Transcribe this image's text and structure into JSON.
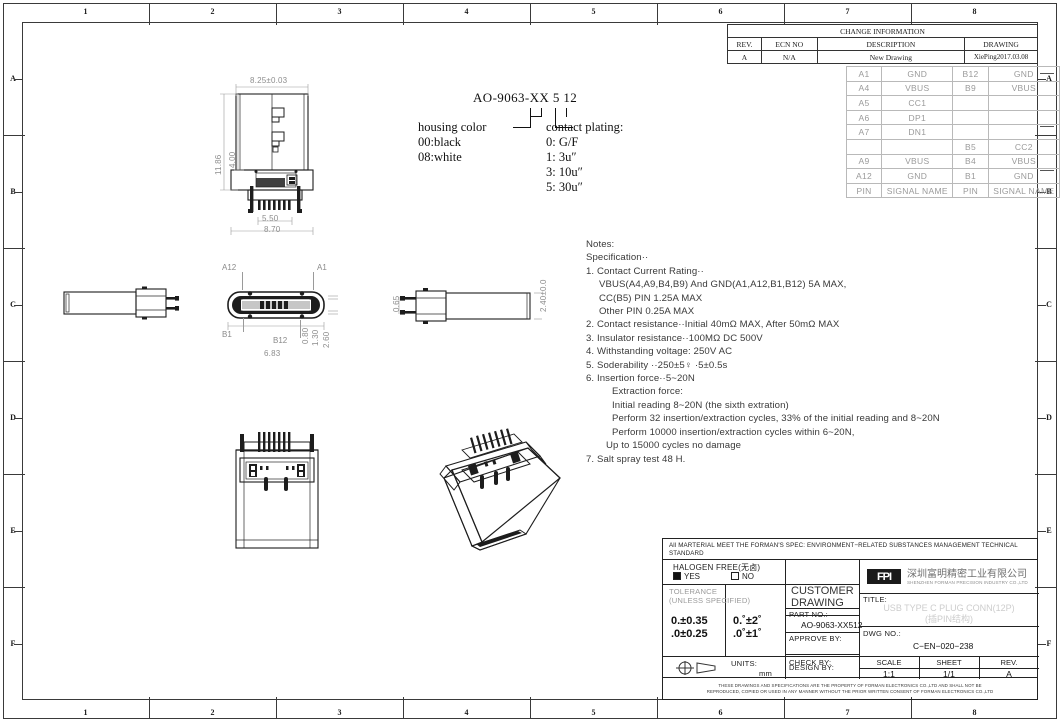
{
  "sheet": {
    "zones_top": [
      "1",
      "2",
      "3",
      "4",
      "5",
      "6",
      "7",
      "8"
    ],
    "zones_bottom": [
      "1",
      "2",
      "3",
      "4",
      "5",
      "6",
      "7",
      "8"
    ],
    "rows_left": [
      "A",
      "B",
      "C",
      "D",
      "E",
      "F"
    ],
    "rows_right": [
      "A",
      "B",
      "C",
      "D",
      "E",
      "F"
    ]
  },
  "change_info": {
    "title": "CHANGE  INFORMATION",
    "headers": [
      "REV.",
      "ECN NO",
      "DESCRIPTION",
      "DRAWING"
    ],
    "rows": [
      {
        "rev": "A",
        "ecn": "N/A",
        "description": "New Drawing",
        "drawing": "XiePing2017.03.08"
      }
    ]
  },
  "pin_table": {
    "rows": [
      {
        "pin_a": "A1",
        "sig_a": "GND",
        "pin_b": "B12",
        "sig_b": "GND"
      },
      {
        "pin_a": "A4",
        "sig_a": "VBUS",
        "pin_b": "B9",
        "sig_b": "VBUS"
      },
      {
        "pin_a": "A5",
        "sig_a": "CC1",
        "pin_b": "",
        "sig_b": ""
      },
      {
        "pin_a": "A6",
        "sig_a": "DP1",
        "pin_b": "",
        "sig_b": ""
      },
      {
        "pin_a": "A7",
        "sig_a": "DN1",
        "pin_b": "",
        "sig_b": ""
      },
      {
        "pin_a": "",
        "sig_a": "",
        "pin_b": "B5",
        "sig_b": "CC2"
      },
      {
        "pin_a": "A9",
        "sig_a": "VBUS",
        "pin_b": "B4",
        "sig_b": "VBUS"
      },
      {
        "pin_a": "A12",
        "sig_a": "GND",
        "pin_b": "B1",
        "sig_b": "GND"
      },
      {
        "pin_a": "PIN",
        "sig_a": "SIGNAL  NAME",
        "pin_b": "PIN",
        "sig_b": "SIGNAL  NAME"
      }
    ]
  },
  "part_number_legend": {
    "code": "AO-9063-XX 5 12",
    "housing_label": "housing color",
    "housing_options": [
      "00:black",
      "08:white"
    ],
    "plating_label": "contact plating:",
    "plating_options": [
      "0: G/F",
      "1: 3u″",
      "3: 10u″",
      "5: 30u″"
    ]
  },
  "notes": {
    "heading": "Notes:",
    "subheading": "Specification··",
    "lines": [
      {
        "indent": 0,
        "text": "1. Contact Current Rating··"
      },
      {
        "indent": 1,
        "text": "VBUS(A4,A9,B4,B9) And GND(A1,A12,B1,B12) 5A MAX,"
      },
      {
        "indent": 1,
        "text": "CC(B5) PIN 1.25A MAX"
      },
      {
        "indent": 1,
        "text": "Other PIN 0.25A MAX"
      },
      {
        "indent": 0,
        "text": "2. Contact resistance··Initial 40mΩ MAX, After 50mΩ MAX"
      },
      {
        "indent": 0,
        "text": "3. Insulator resistance··100MΩ  DC 500V"
      },
      {
        "indent": 0,
        "text": "4. Withstanding voltage: 250V AC"
      },
      {
        "indent": 0,
        "text": "5. Soderability ··250±5♀ ·5±0.5s"
      },
      {
        "indent": 0,
        "text": "6. Insertion force··5~20N"
      },
      {
        "indent": 2,
        "text": "Extraction force:"
      },
      {
        "indent": 2,
        "text": "Initial reading 8~20N (the sixth extration)"
      },
      {
        "indent": 2,
        "text": "Perform 32 insertion/extraction cycles, 33% of the initial reading and 8~20N"
      },
      {
        "indent": 2,
        "text": "Perform 10000 insertion/extraction cycles within 6~20N,"
      },
      {
        "indent": 3,
        "text": "Up to 15000 cycles no damage"
      },
      {
        "indent": 0,
        "text": "7. Salt spray test 48 H."
      }
    ]
  },
  "dimensions": {
    "front_width_top": "8.25±0.03",
    "front_height_outer": "11.86",
    "front_height_inner": "4.00",
    "front_width_inner": "5.50",
    "front_width_bottom": "8.70",
    "top_view_width": "6.83",
    "top_view_d1": "0.80",
    "top_view_d2": "1.30",
    "top_view_d3": "2.60",
    "side_view_thk": "0.65",
    "side_view_height": "2.40±0.0"
  },
  "pin_callouts": {
    "a12": "A12",
    "a1": "A1",
    "b1": "B1",
    "b12": "B12"
  },
  "title_block": {
    "spec_note": "All MARTERIAL MEET THE FORMAN'S SPEC: ENVIRONMENT−RELATED SUBSTANCES MANAGEMENT TECHNICAL STANDARD",
    "halogen_label": "HALOGEN  FREE(无卤)",
    "halogen_yes": "YES",
    "halogen_no": "NO",
    "tolerance_title": "TOLERANCE",
    "tolerance_sub": "(UNLESS  SPECIFIED)",
    "tolerance_line1_l": "0.±0.35",
    "tolerance_line1_r": "0.˚±2˚",
    "tolerance_line2_l": ".0±0.25",
    "tolerance_line2_r": ".0˚±1˚",
    "units_label": "UNITS:",
    "units_value": "mm",
    "customer_drawing": "CUSTOMER DRAWING",
    "part_no_label": "PART NO.:",
    "part_no_value": "AO-9063-XX512",
    "approve_label": "APPROVE  BY:",
    "approve_value": "",
    "check_label": "CHECK  BY:",
    "check_value": "",
    "design_label": "DESIGN  BY:",
    "design_value": "",
    "company_cn": "深圳富明精密工业有限公司",
    "company_en": "SHENZHEN FORMAN PRECISION INDUSTRY CO.,LTD",
    "logo_text": "FPI",
    "title_label": "TITLE:",
    "title_value": "USB  TYPE  C  PLUG  CONN(12P)",
    "title_value2": "(插PIN结构)",
    "dwg_no_label": "DWG NO.:",
    "dwg_no_value": "C−EN−020−238",
    "scale_label": "SCALE",
    "scale_value": "1:1",
    "sheet_label": "SHEET",
    "sheet_value": "1/1",
    "rev_label": "REV.",
    "rev_value": "A",
    "disclaimer_line1": "THESE DRAWINGS AND SPECIFICATIONS ARE THE PROPERTY OF FORMAN ELECTRONICS CO.,LTD AND SHALL NOT BE",
    "disclaimer_line2": "REPRODUCED, COPIED OR USED IN ANY MANNER WITHOUT THE PRIOR WRITTEN CONSENT OF FORMAN ELECTRONICS CO.,LTD"
  }
}
